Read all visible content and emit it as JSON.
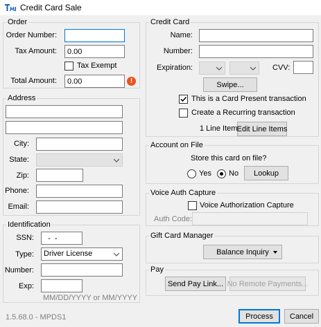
{
  "window": {
    "title": "Credit Card Sale",
    "app_icon": "tmi-logo-icon"
  },
  "order": {
    "legend": "Order",
    "order_number_label": "Order Number:",
    "order_number_value": "",
    "tax_amount_label": "Tax Amount:",
    "tax_amount_value": "0.00",
    "tax_exempt_label": "Tax Exempt",
    "tax_exempt_checked": false,
    "total_amount_label": "Total Amount:",
    "total_amount_value": "0.00",
    "warning_icon": "warning-icon",
    "warning_glyph": "!"
  },
  "address": {
    "legend": "Address",
    "line1_value": "",
    "line2_value": "",
    "city_label": "City:",
    "state_label": "State:",
    "zip_label": "Zip:",
    "phone_label": "Phone:",
    "email_label": "Email:"
  },
  "identification": {
    "legend": "Identification",
    "ssn_label": "SSN:",
    "ssn_value": "  -  -",
    "type_label": "Type:",
    "type_value": "Driver License",
    "number_label": "Number:",
    "exp_label": "Exp:",
    "exp_hint": "MM/DD/YYYY or MM/YYYY"
  },
  "credit_card": {
    "legend": "Credit Card",
    "name_label": "Name:",
    "number_label": "Number:",
    "expiration_label": "Expiration:",
    "cvv_label": "CVV:",
    "swipe_label": "Swipe...",
    "card_present_label": "This is a Card Present transaction",
    "card_present_checked": true,
    "recurring_label": "Create a Recurring transaction",
    "recurring_checked": false,
    "line_item_count": "1 Line Item",
    "edit_line_items_label": "Edit Line Items"
  },
  "account_on_file": {
    "legend": "Account on File",
    "question": "Store this card on file?",
    "yes_label": "Yes",
    "no_label": "No",
    "selected": "No",
    "lookup_label": "Lookup"
  },
  "voice_auth": {
    "legend": "Voice Auth Capture",
    "capture_label": "Voice Authorization Capture",
    "capture_checked": false,
    "auth_code_label": "Auth Code:"
  },
  "gift_card": {
    "legend": "Gift Card Manager",
    "balance_inquiry_label": "Balance Inquiry"
  },
  "pay": {
    "legend": "Pay",
    "send_pay_link_label": "Send Pay Link...",
    "no_remote_payments_label": "No Remote Payments..."
  },
  "footer": {
    "version": "1.5.68.0 - MPDS1",
    "process_label": "Process",
    "cancel_label": "Cancel"
  },
  "colors": {
    "accent": "#0078d7",
    "warning": "#e8531d"
  }
}
